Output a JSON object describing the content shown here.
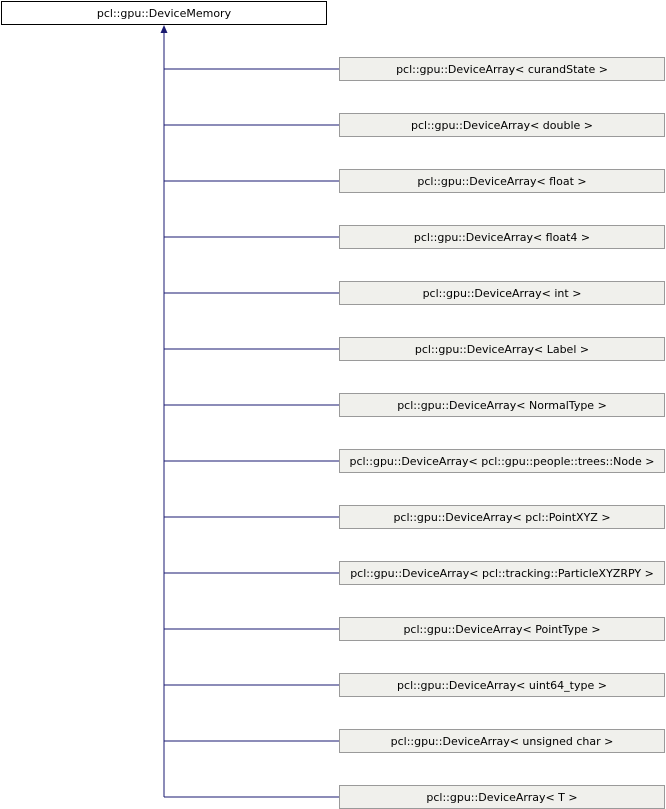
{
  "base": {
    "label": "pcl::gpu::DeviceMemory"
  },
  "children": [
    {
      "label": "pcl::gpu::DeviceArray< curandState >"
    },
    {
      "label": "pcl::gpu::DeviceArray< double >"
    },
    {
      "label": "pcl::gpu::DeviceArray< float >"
    },
    {
      "label": "pcl::gpu::DeviceArray< float4 >"
    },
    {
      "label": "pcl::gpu::DeviceArray< int >"
    },
    {
      "label": "pcl::gpu::DeviceArray< Label >"
    },
    {
      "label": "pcl::gpu::DeviceArray< NormalType >"
    },
    {
      "label": "pcl::gpu::DeviceArray< pcl::gpu::people::trees::Node >"
    },
    {
      "label": "pcl::gpu::DeviceArray< pcl::PointXYZ >"
    },
    {
      "label": "pcl::gpu::DeviceArray< pcl::tracking::ParticleXYZRPY >"
    },
    {
      "label": "pcl::gpu::DeviceArray< PointType >"
    },
    {
      "label": "pcl::gpu::DeviceArray< uint64_type >"
    },
    {
      "label": "pcl::gpu::DeviceArray< unsigned char >"
    },
    {
      "label": "pcl::gpu::DeviceArray< T >"
    }
  ],
  "colors": {
    "edge": "#191970",
    "node_fill": "#f0f0ec",
    "node_border": "#9a9a9a",
    "base_border": "#000000"
  }
}
